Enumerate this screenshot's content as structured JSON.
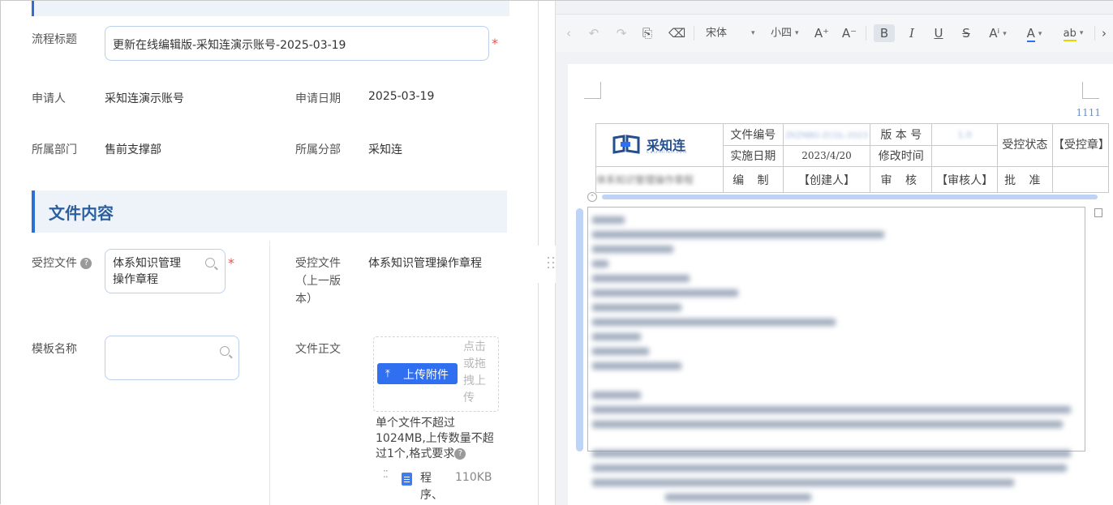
{
  "form": {
    "flow_title_label": "流程标题",
    "flow_title_value": "更新在线编辑版-采知连演示账号-2025-03-19",
    "applicant_label": "申请人",
    "applicant_value": "采知连演示账号",
    "apply_date_label": "申请日期",
    "apply_date_value": "2025-03-19",
    "dept_label": "所属部门",
    "dept_value": "售前支撑部",
    "branch_label": "所属分部",
    "branch_value": "采知连",
    "section_title": "文件内容",
    "controlled_file_label": "受控文件",
    "controlled_file_value": "体系知识管理操作章程",
    "prev_file_label": "受控文件（上一版本）",
    "prev_file_value": "体系知识管理操作章程",
    "template_label": "模板名称",
    "template_value": "",
    "body_label": "文件正文",
    "upload_button": "上传附件",
    "drop_hint": "点击或拖拽上传",
    "upload_rule": "单个文件不超过1024MB,上传数量不超过1个,格式要求",
    "attachment_name": "程序、",
    "attachment_size": "110KB",
    "required_mark": "*",
    "help_glyph": "?"
  },
  "editor": {
    "toolbar": {
      "font_family": "宋体",
      "font_size": "小四",
      "grow_font": "A⁺",
      "shrink_font": "A⁻",
      "bold": "B",
      "italic": "I",
      "underline": "U",
      "strike": "S",
      "superscript": "Aⁱ",
      "font_color": "A",
      "highlight": "ab"
    },
    "page_number": "1111",
    "header_table": {
      "logo_text": "采知连",
      "logo_sub": "Caizhilian.com",
      "doc_no_label": "文件编号",
      "doc_no_value": "ZKZNBG-ZCGL-2023",
      "version_label": "版 本 号",
      "version_value": "1.0",
      "status_label": "受控状态",
      "status_value": "【受控章】",
      "impl_date_label": "实施日期",
      "impl_date_value": "2023/4/20",
      "modify_label": "修改时间",
      "modify_value": "",
      "title_blurred": "体系知识管理操作章程",
      "compile_label": "编  制",
      "compile_value": "【创建人】",
      "review_label": "审  核",
      "review_value": "【审核人】",
      "approve_label": "批  准",
      "approve_value": ""
    }
  },
  "colors": {
    "accent": "#2f6ff0",
    "section_bg": "#eef3fa",
    "section_title": "#2c5f9e",
    "required": "#e8504d",
    "editor_blue_text": "#4b80cc"
  }
}
